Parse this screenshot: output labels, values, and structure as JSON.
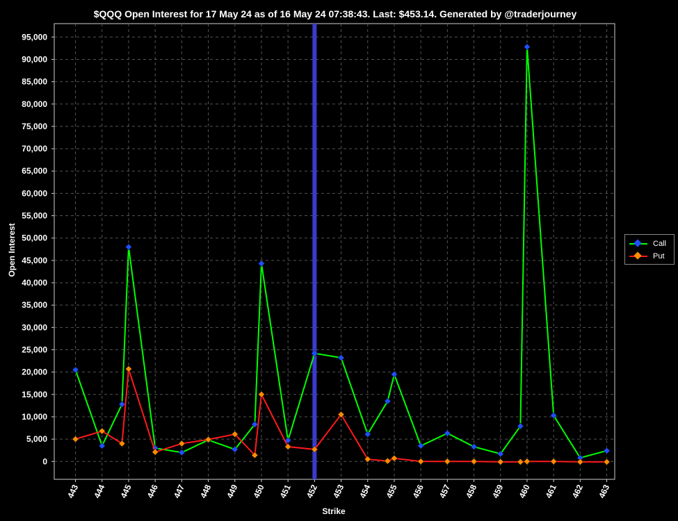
{
  "chart_data": {
    "type": "line",
    "title": "$QQQ Open Interest for 17 May 24 as of 16 May 24 07:38:43.  Last: $453.14.  Generated by @traderjourney",
    "xlabel": "Strike",
    "ylabel": "Open Interest",
    "x_ticks": [
      "443",
      "444",
      "445",
      "446",
      "447",
      "448",
      "449",
      "450",
      "451",
      "452",
      "453",
      "454",
      "455",
      "456",
      "457",
      "458",
      "459",
      "460",
      "461",
      "462",
      "463"
    ],
    "y_ticks": [
      "0",
      "5,000",
      "10,000",
      "15,000",
      "20,000",
      "25,000",
      "30,000",
      "35,000",
      "40,000",
      "45,000",
      "50,000",
      "55,000",
      "60,000",
      "65,000",
      "70,000",
      "75,000",
      "80,000",
      "85,000",
      "90,000",
      "95,000"
    ],
    "ylim": [
      -4000,
      98000
    ],
    "xlim": [
      442.2,
      463.3
    ],
    "last_price": 453.14,
    "spot_line_strike": 452,
    "grid": true,
    "legend_position": "right",
    "series": [
      {
        "name": "Call",
        "line_color": "#00ff00",
        "marker_color": "#1e50ff",
        "points": [
          [
            443,
            20500
          ],
          [
            444,
            3500
          ],
          [
            444.75,
            12800
          ],
          [
            445,
            48000
          ],
          [
            446,
            3000
          ],
          [
            447,
            2000
          ],
          [
            448,
            4800
          ],
          [
            449,
            2700
          ],
          [
            449.75,
            8300
          ],
          [
            450,
            44300
          ],
          [
            451,
            4700
          ],
          [
            452,
            24200
          ],
          [
            453,
            23200
          ],
          [
            454,
            6100
          ],
          [
            454.75,
            13500
          ],
          [
            455,
            19500
          ],
          [
            456,
            3500
          ],
          [
            457,
            6300
          ],
          [
            458,
            3300
          ],
          [
            459,
            1700
          ],
          [
            459.75,
            7900
          ],
          [
            460,
            92800
          ],
          [
            461,
            10300
          ],
          [
            462,
            800
          ],
          [
            463,
            2400
          ]
        ]
      },
      {
        "name": "Put",
        "line_color": "#ff1a1a",
        "marker_color": "#ff8c00",
        "points": [
          [
            443,
            5000
          ],
          [
            444,
            6800
          ],
          [
            444.75,
            4000
          ],
          [
            445,
            20700
          ],
          [
            446,
            2100
          ],
          [
            447,
            4000
          ],
          [
            448,
            4900
          ],
          [
            449,
            6100
          ],
          [
            449.75,
            1400
          ],
          [
            450,
            15000
          ],
          [
            451,
            3300
          ],
          [
            452,
            2700
          ],
          [
            453,
            10500
          ],
          [
            454,
            500
          ],
          [
            454.75,
            100
          ],
          [
            455,
            700
          ],
          [
            456,
            0
          ],
          [
            457,
            0
          ],
          [
            458,
            0
          ],
          [
            459,
            -100
          ],
          [
            459.75,
            -100
          ],
          [
            460,
            0
          ],
          [
            461,
            0
          ],
          [
            462,
            -100
          ],
          [
            463,
            -100
          ]
        ]
      }
    ]
  },
  "legend": {
    "call_label": "Call",
    "put_label": "Put"
  }
}
